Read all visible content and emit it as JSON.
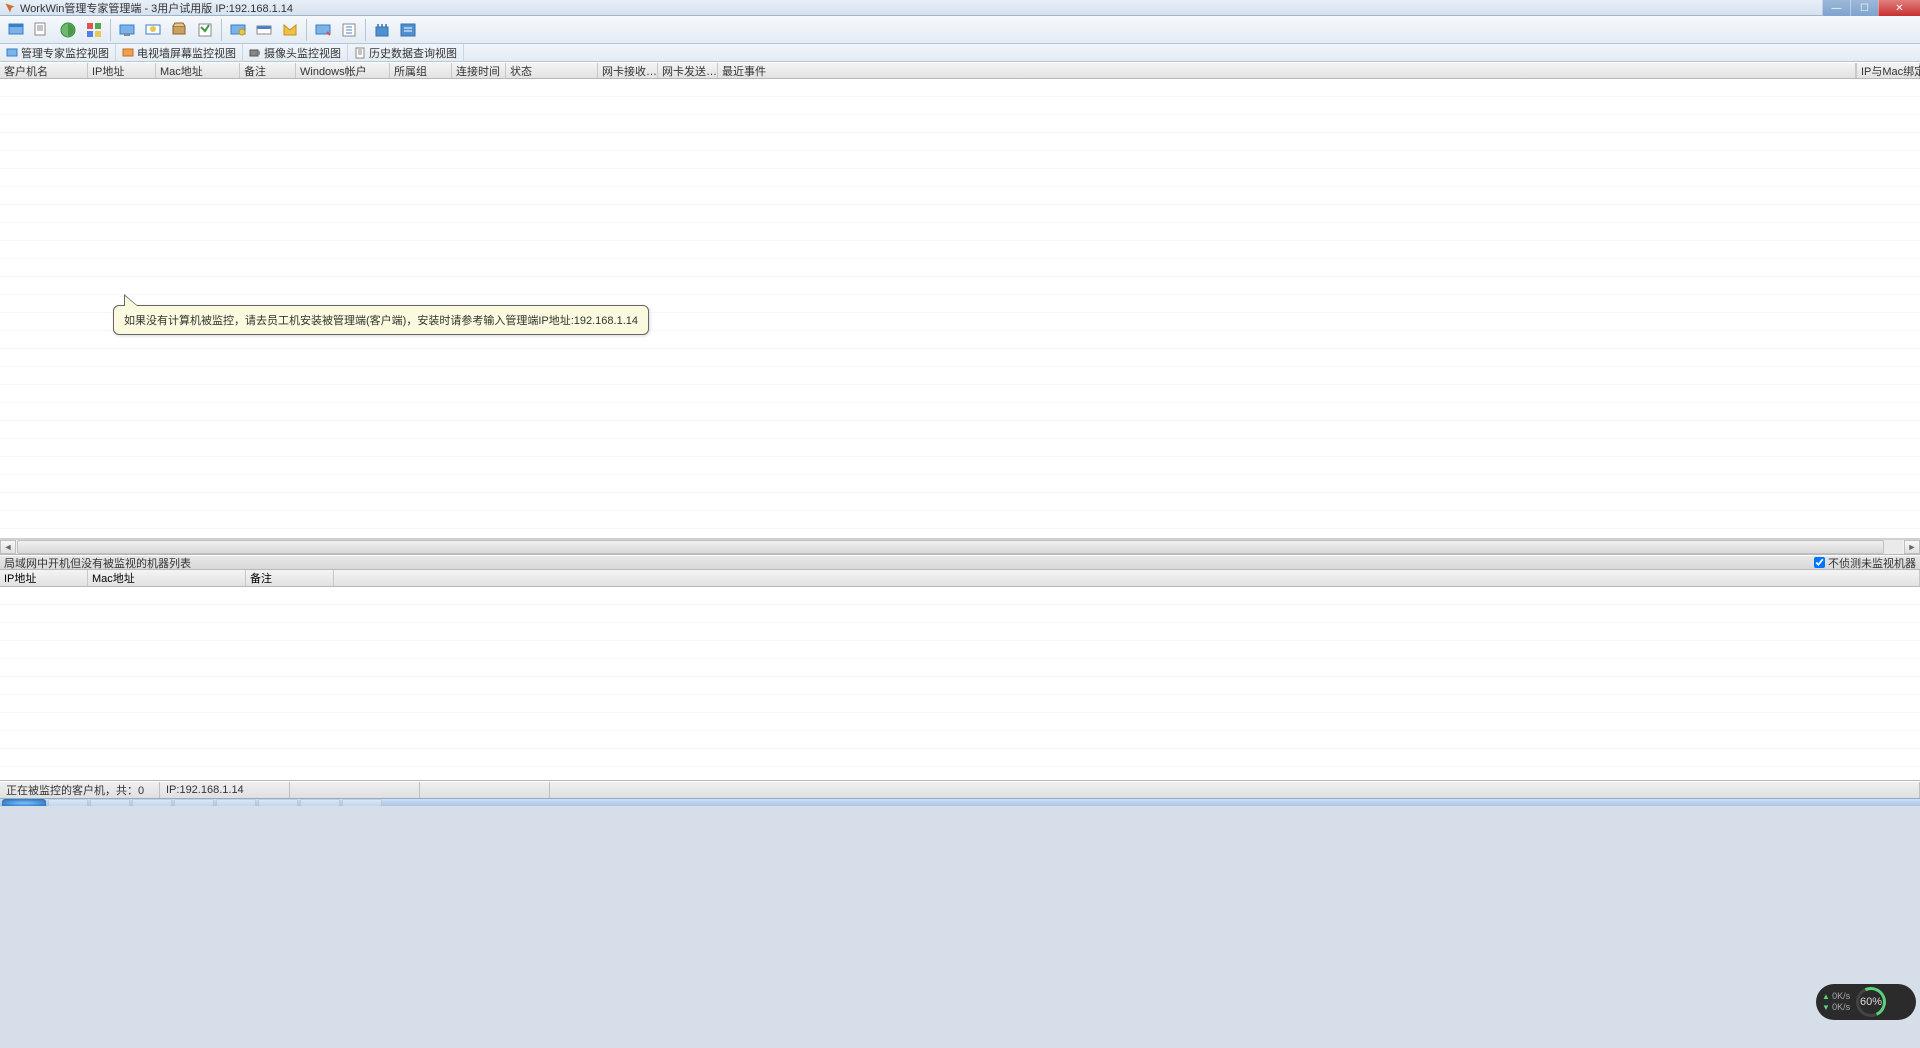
{
  "titlebar": {
    "title": "WorkWin管理专家管理端 - 3用户试用版 IP:192.168.1.14"
  },
  "viewtabs": {
    "tab1": "管理专家监控视图",
    "tab2": "电视墙屏幕监控视图",
    "tab3": "摄像头监控视图",
    "tab4": "历史数据查询视图"
  },
  "main_columns": {
    "c1": "客户机名",
    "c2": "IP地址",
    "c3": "Mac地址",
    "c4": "备注",
    "c5": "Windows帐户",
    "c6": "所属组",
    "c7": "连接时间",
    "c8": "状态",
    "c9": "网卡接收…",
    "c10": "网卡发送…",
    "c11": "最近事件",
    "c12": "IP与Mac绑定"
  },
  "balloon_text": "如果没有计算机被监控，请去员工机安装被管理端(客户端)，安装时请参考输入管理端IP地址:192.168.1.14",
  "section2_title": "局域网中开机但没有被监视的机器列表",
  "section2_checkbox": "不侦测未监视机器",
  "lower_columns": {
    "c1": "IP地址",
    "c2": "Mac地址",
    "c3": "备注"
  },
  "statusbar": {
    "s1": "正在被监控的客户机，共：0",
    "s2": "IP:192.168.1.14"
  },
  "netwidget": {
    "up": "0K/s",
    "dn": "0K/s",
    "pct": "60%"
  }
}
